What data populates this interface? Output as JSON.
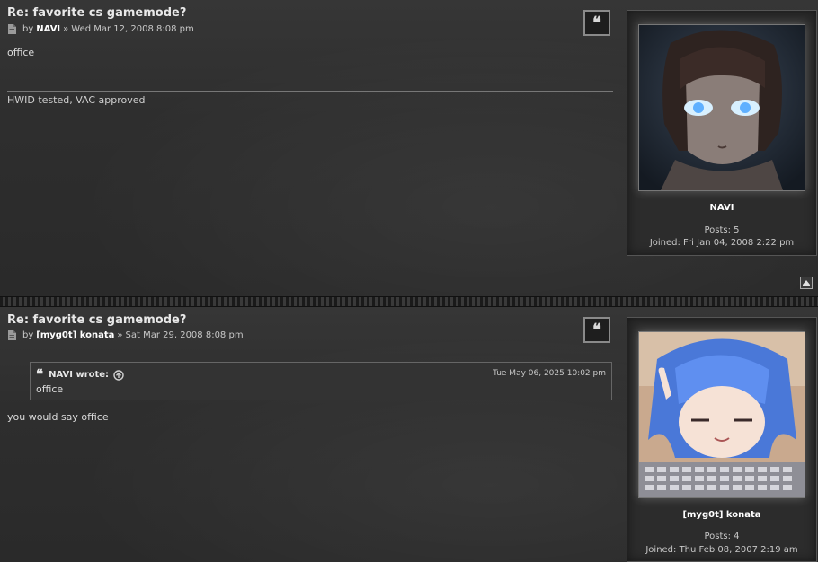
{
  "posts": [
    {
      "title": "Re: favorite cs gamemode?",
      "by_label": "by",
      "author": "NAVI",
      "sep": "»",
      "date": "Wed Mar 12, 2008 8:08 pm",
      "content": "office",
      "signature": "HWID tested, VAC approved",
      "quote_icon": "quote-icon",
      "profile": {
        "username": "NAVI",
        "posts": "Posts: 5",
        "joined": "Joined: Fri Jan 04, 2008 2:22 pm"
      }
    },
    {
      "title": "Re: favorite cs gamemode?",
      "by_label": "by",
      "author": "[myg0t] konata",
      "sep": "»",
      "date": "Sat Mar 29, 2008 8:08 pm",
      "quote": {
        "cite": "NAVI wrote:",
        "date": "Tue May 06, 2025 10:02 pm",
        "text": "office"
      },
      "content": "you would say office",
      "quote_icon": "quote-icon",
      "profile": {
        "username": "[myg0t] konata",
        "posts": "Posts: 4",
        "joined": "Joined: Thu Feb 08, 2007 2:19 am"
      }
    }
  ],
  "icons": {
    "quote_glyph": "❝",
    "back_to_top": "back-to-top-icon",
    "document": "document-icon",
    "go_to_post": "arrow-up-circle-icon"
  },
  "colors": {
    "background": "#2a2a2a",
    "text": "#d8d8d8",
    "username": "#ffffff"
  }
}
